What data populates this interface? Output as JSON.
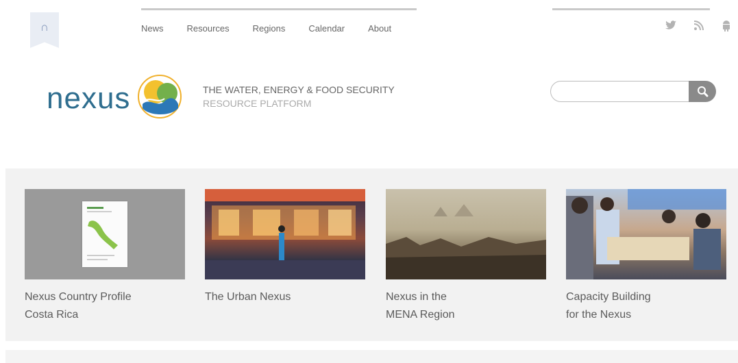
{
  "header": {
    "home_icon": "nexus-n-icon",
    "nav": [
      "News",
      "Resources",
      "Regions",
      "Calendar",
      "About"
    ],
    "social_icons": [
      "twitter-icon",
      "rss-icon",
      "android-icon"
    ]
  },
  "brand": {
    "logo_text": "nexus",
    "tagline_line1": "THE WATER, ENERGY & FOOD SECURITY",
    "tagline_line2": "RESOURCE PLATFORM",
    "colors": {
      "logo": "#2f6e8f",
      "sun": "#f3c12f",
      "leaf": "#73b04b",
      "water": "#2c78b7"
    }
  },
  "search": {
    "placeholder": "",
    "value": "",
    "button_icon": "search-icon"
  },
  "featured": [
    {
      "caption_line1": "Nexus Country Profile",
      "caption_line2": "Costa Rica"
    },
    {
      "caption_line1": "The Urban Nexus",
      "caption_line2": ""
    },
    {
      "caption_line1": "Nexus in the",
      "caption_line2": "MENA Region"
    },
    {
      "caption_line1": "Capacity Building",
      "caption_line2": "for the Nexus"
    }
  ]
}
